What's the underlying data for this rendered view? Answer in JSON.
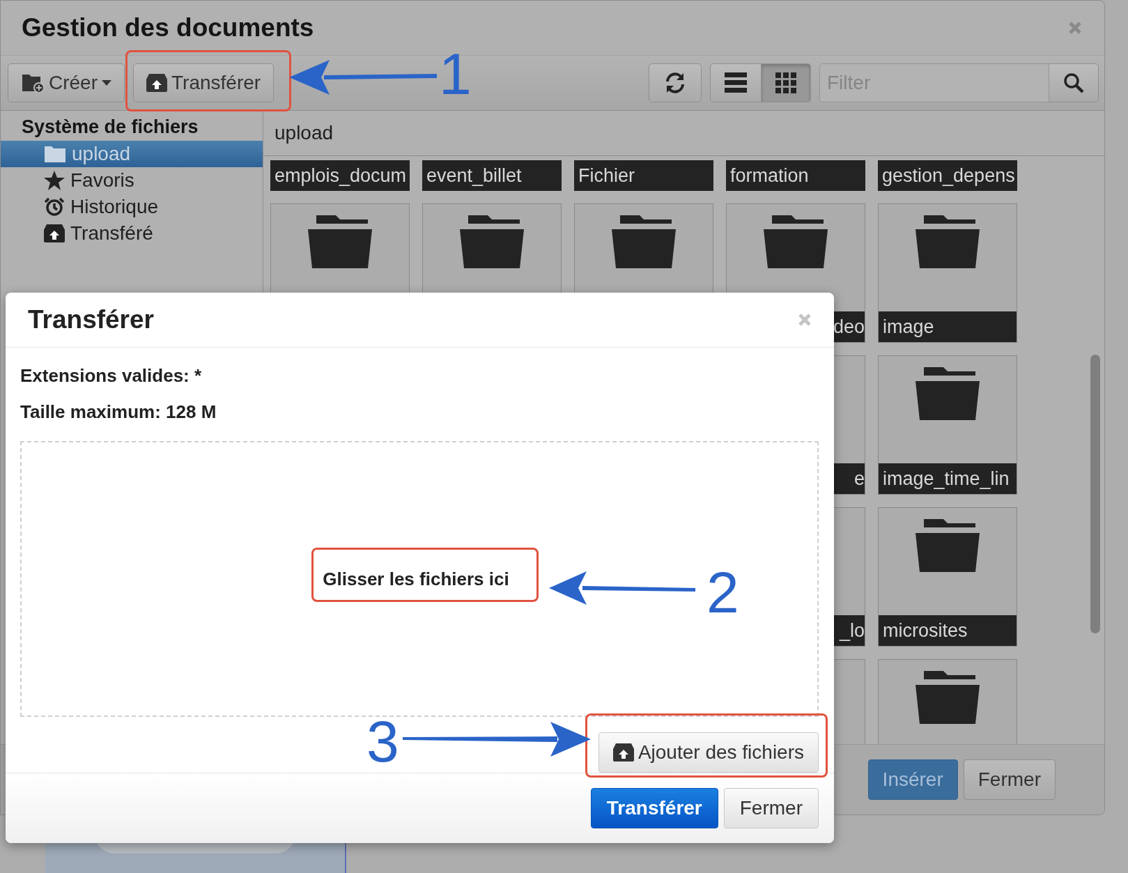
{
  "window": {
    "title": "Gestion des documents"
  },
  "toolbar": {
    "create_button": "Créer",
    "upload_button": "Transférer",
    "view_buttons": [
      {
        "kind": "list",
        "selected": false
      },
      {
        "kind": "grid",
        "selected": true
      }
    ],
    "filter": {
      "placeholder": "Filter"
    }
  },
  "sidebar": {
    "heading": "Système de fichiers",
    "items": [
      {
        "label": "upload",
        "kind": "folder",
        "selected": true
      },
      {
        "label": "Favoris",
        "kind": "star",
        "selected": false
      },
      {
        "label": "Historique",
        "kind": "alarm",
        "selected": false
      },
      {
        "label": "Transféré",
        "kind": "upload",
        "selected": false
      }
    ]
  },
  "path": "upload",
  "grid": {
    "rows": [
      [
        {
          "kind": "label",
          "label": "emplois_docum"
        },
        {
          "kind": "label",
          "label": "event_billet"
        },
        {
          "kind": "label",
          "label": "Fichier"
        },
        {
          "kind": "label",
          "label": "formation"
        },
        {
          "kind": "label",
          "label": "gestion_depens"
        }
      ],
      [
        {
          "kind": "folder"
        },
        {
          "kind": "folder"
        },
        {
          "kind": "folder"
        },
        {
          "kind": "folder_cut",
          "label": "deo"
        },
        {
          "kind": "folder",
          "label": "image"
        }
      ],
      [
        "",
        "",
        "",
        {
          "kind": "sliver",
          "label": "e"
        },
        {
          "kind": "folder",
          "label": "image_time_lin"
        }
      ],
      [
        "",
        "",
        "",
        {
          "kind": "sliver",
          "label": "_lo"
        },
        {
          "kind": "folder",
          "label": "microsites"
        }
      ],
      [
        "",
        "",
        "",
        {
          "kind": "sliver"
        },
        {
          "kind": "folder"
        }
      ]
    ]
  },
  "footer_buttons": [
    {
      "label": "Insérer",
      "kind": "primary"
    },
    {
      "label": "Fermer",
      "kind": "default"
    }
  ],
  "dialog": {
    "title": "Transférer",
    "info_lines": [
      "Extensions valides: *",
      "Taille maximum: 128 M"
    ],
    "dropzone_text": "Glisser les fichiers ici",
    "add_button": "Ajouter des fichiers",
    "buttons": [
      {
        "label": "Transférer",
        "kind": "primary"
      },
      {
        "label": "Fermer",
        "kind": "default"
      }
    ]
  },
  "annotations": [
    {
      "number": "1"
    },
    {
      "number": "2"
    },
    {
      "number": "3"
    }
  ]
}
